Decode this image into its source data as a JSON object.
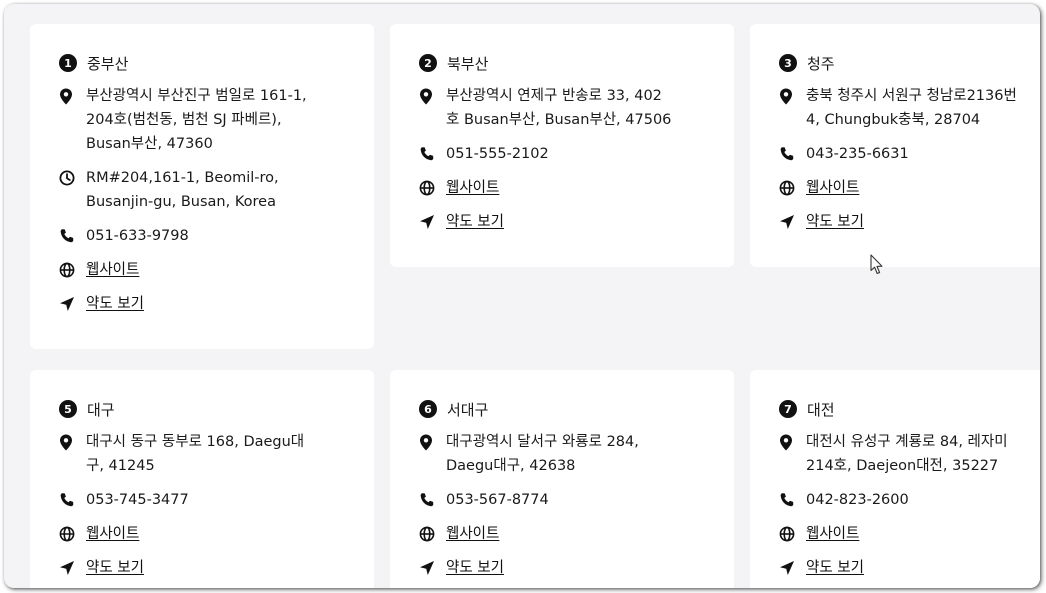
{
  "cards": [
    {
      "number": "1",
      "city": "중부산",
      "address": "부산광역시 부산진구 범일로 161-1,\n204호(범천동, 범천 SJ 파베르),\nBusan부산, 47360",
      "hours": "RM#204,161-1, Beomil-ro,\nBusanjin-gu, Busan, Korea",
      "phone": "051-633-9798",
      "website_label": "웹사이트",
      "map_label": "약도 보기"
    },
    {
      "number": "2",
      "city": "북부산",
      "address": "부산광역시 연제구 반송로 33, 402\n호 Busan부산, Busan부산, 47506",
      "phone": "051-555-2102",
      "website_label": "웹사이트",
      "map_label": "약도 보기"
    },
    {
      "number": "3",
      "city": "청주",
      "address": "충북 청주시 서원구 청남로2136번\n4, Chungbuk충북, 28704",
      "phone": "043-235-6631",
      "website_label": "웹사이트",
      "map_label": "약도 보기"
    },
    {
      "number": "5",
      "city": "대구",
      "address": "대구시 동구 동부로 168, Daegu대\n구, 41245",
      "phone": "053-745-3477",
      "website_label": "웹사이트",
      "map_label": "약도 보기"
    },
    {
      "number": "6",
      "city": "서대구",
      "address": "대구광역시 달서구 와룡로 284,\nDaegu대구, 42638",
      "phone": "053-567-8774",
      "website_label": "웹사이트",
      "map_label": "약도 보기"
    },
    {
      "number": "7",
      "city": "대전",
      "address": "대전시 유성구 계룡로 84, 레자미\n214호, Daejeon대전, 35227",
      "phone": "042-823-2600",
      "website_label": "웹사이트",
      "map_label": "약도 보기"
    }
  ],
  "icons": {
    "number_badge": "number-badge",
    "address": "map-pin-icon",
    "hours": "clock-icon",
    "phone": "phone-icon",
    "website": "globe-icon",
    "map": "navigation-arrow-icon",
    "pointer": "mouse-cursor-icon"
  },
  "colors": {
    "background": "#f4f4f6",
    "card": "#ffffff",
    "text": "#1a1a1a",
    "badge": "#111111"
  }
}
